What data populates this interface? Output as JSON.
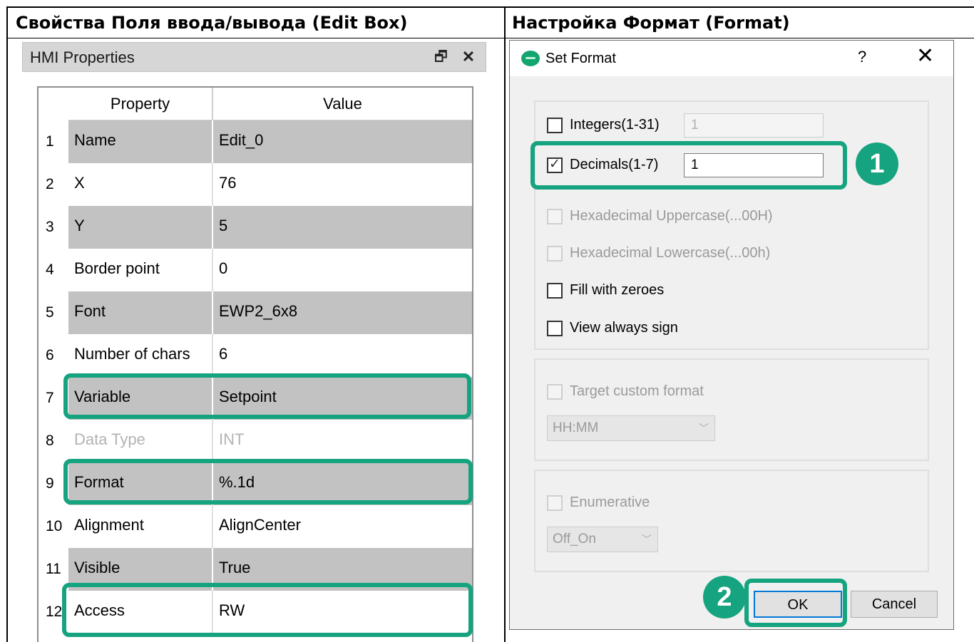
{
  "headings": {
    "left": "Свойства Поля ввода/вывода (Edit Box)",
    "right": "Настройка Формат (Format)"
  },
  "hmi_panel": {
    "title": "HMI Properties",
    "float_icon": "float-window-icon",
    "close_icon": "close-icon",
    "columns": {
      "property": "Property",
      "value": "Value"
    },
    "rows": [
      {
        "num": "1",
        "property": "Name",
        "value": "Edit_0"
      },
      {
        "num": "2",
        "property": "X",
        "value": "76"
      },
      {
        "num": "3",
        "property": "Y",
        "value": "5"
      },
      {
        "num": "4",
        "property": "Border point",
        "value": "0"
      },
      {
        "num": "5",
        "property": "Font",
        "value": "EWP2_6x8"
      },
      {
        "num": "6",
        "property": "Number of chars",
        "value": "6"
      },
      {
        "num": "7",
        "property": "Variable",
        "value": "Setpoint"
      },
      {
        "num": "8",
        "property": "Data Type",
        "value": "INT"
      },
      {
        "num": "9",
        "property": "Format",
        "value": "%.1d"
      },
      {
        "num": "10",
        "property": "Alignment",
        "value": "AlignCenter"
      },
      {
        "num": "11",
        "property": "Visible",
        "value": "True"
      },
      {
        "num": "12",
        "property": "Access",
        "value": "RW"
      }
    ]
  },
  "set_format": {
    "title": "Set Format",
    "help": "?",
    "close": "✕",
    "integers": {
      "label": "Integers(1-31)",
      "checked": false,
      "value": "1"
    },
    "decimals": {
      "label": "Decimals(1-7)",
      "checked": true,
      "value": "1"
    },
    "hex_upper": {
      "label": "Hexadecimal Uppercase(...00H)",
      "checked": false
    },
    "hex_lower": {
      "label": "Hexadecimal Lowercase(...00h)",
      "checked": false
    },
    "fill_zeroes": {
      "label": "Fill with zeroes",
      "checked": false
    },
    "always_sign": {
      "label": "View always sign",
      "checked": false
    },
    "custom_format": {
      "label": "Target custom format",
      "checked": false,
      "selected": "HH:MM"
    },
    "enumerative": {
      "label": "Enumerative",
      "checked": false,
      "selected": "Off_On"
    },
    "ok_label": "OK",
    "cancel_label": "Cancel"
  },
  "badges": {
    "one": "1",
    "two": "2"
  },
  "colors": {
    "highlight": "#16a37f",
    "shaded_row": "#c2c2c2",
    "dialog_bg": "#f0f0f0",
    "default_button_border": "#0078d7"
  }
}
